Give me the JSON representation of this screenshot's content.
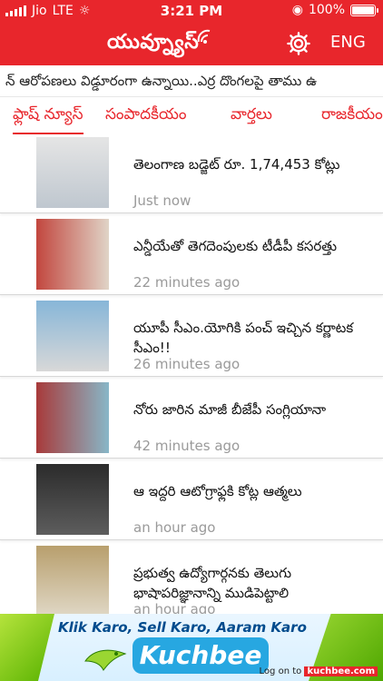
{
  "status_bar": {
    "carrier": "Jio",
    "network": "LTE",
    "time": "3:21 PM",
    "battery": "100%"
  },
  "app_bar": {
    "logo_text": "యువ్న్యూస్",
    "language": "ENG",
    "icons": [
      "wifi-logo-icon",
      "gear-icon"
    ]
  },
  "ticker": {
    "text": "న్ ఆరోపణలు విడ్డూరంగా ఉన్నాయి..ఎర్ర దొంగలపై తాము ఉ"
  },
  "tabs": [
    {
      "label": "ఫ్లాష్ న్యూస్",
      "active": true
    },
    {
      "label": "సంపాదకీయం"
    },
    {
      "label": "వార్తలు"
    },
    {
      "label": "రాజకీయం"
    }
  ],
  "news": [
    {
      "title": "తెలంగాణ బడ్జెట్ రూ. 1,74,453 కోట్లు",
      "time": "Just now"
    },
    {
      "title": "ఎన్డీయేతో తెగదెంపులకు టీడీపీ కసరత్తు",
      "time": "22 minutes ago"
    },
    {
      "title": "యూపీ సీఎం.యోగికి పంచ్ ఇచ్చిన కర్ణాటక సీఎం!!",
      "time": "26 minutes ago"
    },
    {
      "title": "నోరు జారిన మాజీ బీజేపీ సంగ్లియానా",
      "time": "42 minutes ago"
    },
    {
      "title": "ఆ ఇద్దరి ఆటోగ్రాఫ్లకి కోట్ల ఆత్మలు",
      "time": "an hour ago"
    },
    {
      "title": "ప్రభుత్వ ఉద్యోగార్గనకు తెలుగు భాషాపరిజ్ఞానాన్ని ముడిపెట్టాలి",
      "time": "an hour ago"
    }
  ],
  "ad": {
    "tagline": "Klik Karo, Sell Karo, Aaram Karo",
    "brand": "Kuchbee",
    "login_text": "Log on to",
    "url": "kuchbee.com"
  }
}
